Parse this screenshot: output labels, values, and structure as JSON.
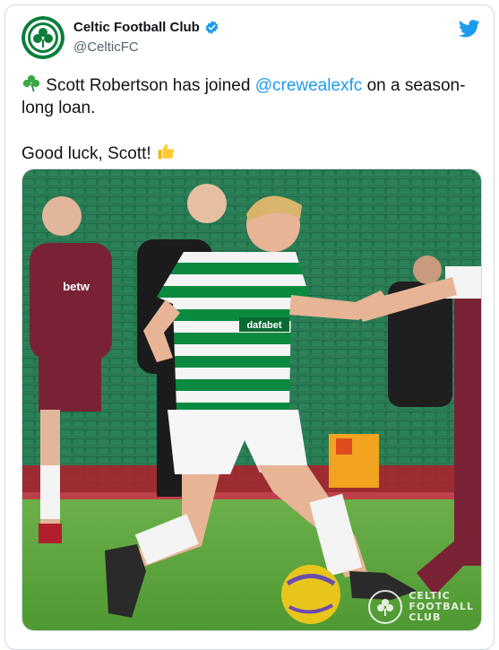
{
  "author": {
    "name": "Celtic Football Club",
    "handle": "@CelticFC",
    "verified": true,
    "avatar_icon": "celtic-crest-icon"
  },
  "tweet": {
    "emoji_lead": "shamrock-icon",
    "line1_a": "Scott Robertson has joined ",
    "mention": "@crewealexfc",
    "line1_b": " on a season-long loan.",
    "line2": "Good luck, Scott!",
    "emoji_tail": "thumbs-up-icon"
  },
  "media": {
    "watermark": [
      "CELTIC",
      "FOOTBALL",
      "CLUB"
    ],
    "shirt_sponsor": "dafabet",
    "opponent_sponsor": "betw"
  },
  "colors": {
    "accent": "#1d9bf0",
    "celtic_green": "#0a7d3b",
    "pitch": "#5aa53a"
  }
}
